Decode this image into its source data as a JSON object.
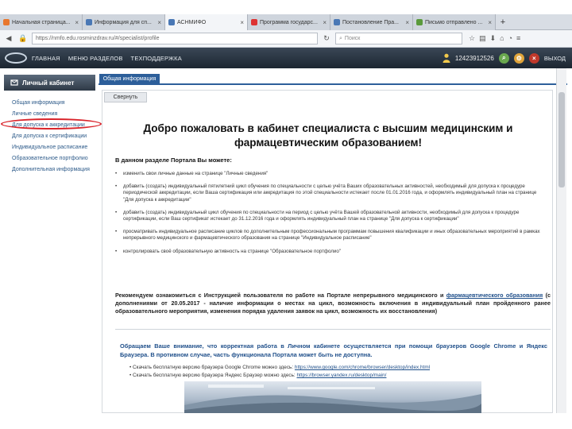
{
  "browser": {
    "tabs": [
      {
        "title": "Начальная страница...",
        "color": "#e8772e",
        "active": false
      },
      {
        "title": "Информация для сп...",
        "color": "#4a78b5",
        "active": false
      },
      {
        "title": "АСНМИФО",
        "color": "#4a78b5",
        "active": true
      },
      {
        "title": "Программа государс...",
        "color": "#d33",
        "active": false
      },
      {
        "title": "Постановление Пра...",
        "color": "#4a78b5",
        "active": false
      },
      {
        "title": "Письмо отправлено ...",
        "color": "#5a9a3c",
        "active": false
      }
    ],
    "new_tab": "+",
    "url": "https://nmfo.edu.rosminzdrav.ru/#/specialist/profile",
    "search_placeholder": "Поиск"
  },
  "site": {
    "nav": [
      "ГЛАВНАЯ",
      "МЕНЮ РАЗДЕЛОВ",
      "ТЕХПОДДЕРЖКА"
    ],
    "user_id": "12423912526",
    "exit": "ВЫХОД"
  },
  "sidebar": {
    "title": "Личный кабинет",
    "items": [
      "Общая информация",
      "Личные сведения",
      "Для допуска к аккредитации",
      "Для допуска к сертификации",
      "Индивидуальное расписание",
      "Образовательное портфолио",
      "Дополнительная информация"
    ]
  },
  "main": {
    "tab": "Общая информация",
    "collapse_button": "Свернуть",
    "welcome": "Добро пожаловать в кабинет специалиста с высшим медицинским и фармацевтическим образованием!",
    "intro": "В данном разделе Портала Вы можете:",
    "bullets": [
      "изменить свои личные данные на странице \"Личные сведения\"",
      "добавить (создать) индивидуальный пятилетний цикл обучения по специальности с целью учёта Ваших образовательных активностей, необходимый для допуска к процедуре периодической аккредитации, если Ваша сертификация или аккредитация по этой специальности истекает после 01.01.2016 года, и оформлять индивидуальный план на странице \"Для допуска к аккредитации\"",
      "добавить (создать) индивидуальный цикл обучения по специальности на период с целью учёта Вашей образовательной активности, необходимый для допуска к процедуре сертификации, если Ваш сертификат истекает до 31.12.2016 года и оформлять индивидуальный план на странице \"Для допуска к сертификации\"",
      "просматривать индивидуальное расписание циклов по дополнительным профессиональным программам повышения квалификации и иных образовательных мероприятий в рамках непрерывного медицинского и фармацевтического образования на странице \"Индивидуальное расписание\"",
      "контролировать своё образовательную активность на странице \"Образовательное портфолио\""
    ],
    "recommend_pre": "Рекомендуем ознакомиться с Инструкцией пользователя по работе на Портале непрерывного медицинского и ",
    "recommend_link": "фармацевтического образования",
    "recommend_post": " (с дополнениями от 20.05.2017 - наличие информации о местах на цикл, возможность включения в индивидуальный план пройденного ранее образовательного мероприятия, изменения порядка удаления заявок на цикл, возможность их восстановления)",
    "notice": "Обращаем Ваше внимание, что корректная работа в Личном кабинете осуществляется при помощи браузеров Google Chrome и Яндекс Браузера. В противном случае, часть функционала Портала может быть не доступна.",
    "downloads": [
      {
        "text": "Скачать бесплатную версию браузера Google Chrome можно здесь: ",
        "link": "https://www.google.com/chrome/browser/desktop/index.html"
      },
      {
        "text": "Скачать бесплатную версию браузера Яндекс Браузер можно здесь: ",
        "link": "https://browser.yandex.ru/desktop/main/"
      }
    ]
  }
}
